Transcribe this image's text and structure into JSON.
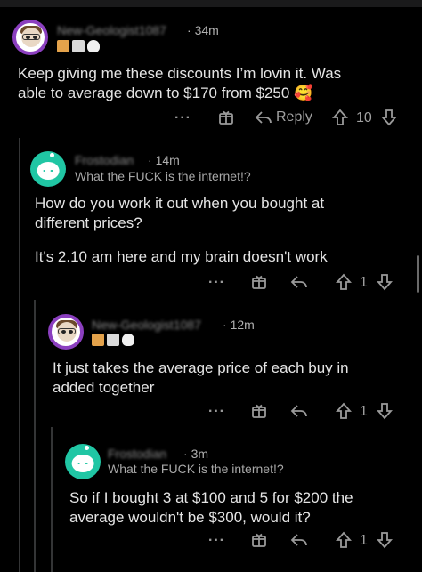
{
  "comments": [
    {
      "username": "New-Geologist1087",
      "time": "34m",
      "text_lines": [
        "Keep giving me these discounts I’m lovin it. Was",
        "able to average down to $170 from $250 🥰"
      ],
      "reply_label": "Reply",
      "votes": "10"
    },
    {
      "username": "Frostodian",
      "time": "14m",
      "flair": "What the FUCK is the internet!?",
      "text_lines": [
        "How do you work it out when you bought at",
        "different prices?",
        "",
        "It's 2.10 am  here and my brain doesn't work"
      ],
      "votes": "1"
    },
    {
      "username": "New-Geologist1087",
      "time": "12m",
      "text_lines": [
        "It just takes the average price of each buy in",
        "added together"
      ],
      "votes": "1"
    },
    {
      "username": "Frostodian",
      "time": "3m",
      "flair": "What the FUCK is the internet!?",
      "text_lines": [
        "So if I bought 3 at $100 and 5 for $200 the",
        "average wouldn't be $300, would it?"
      ],
      "votes": "1"
    }
  ],
  "icons": [
    "more-icon",
    "award-icon",
    "reply-icon",
    "upvote-icon",
    "downvote-icon"
  ],
  "colors": {
    "background": "#000000",
    "text": "#e4e4e4",
    "muted": "#9a9a9a",
    "thread_line": "#343536",
    "avatar_teal": "#20c6a4",
    "avatar_ring": "#8b3fbf"
  }
}
